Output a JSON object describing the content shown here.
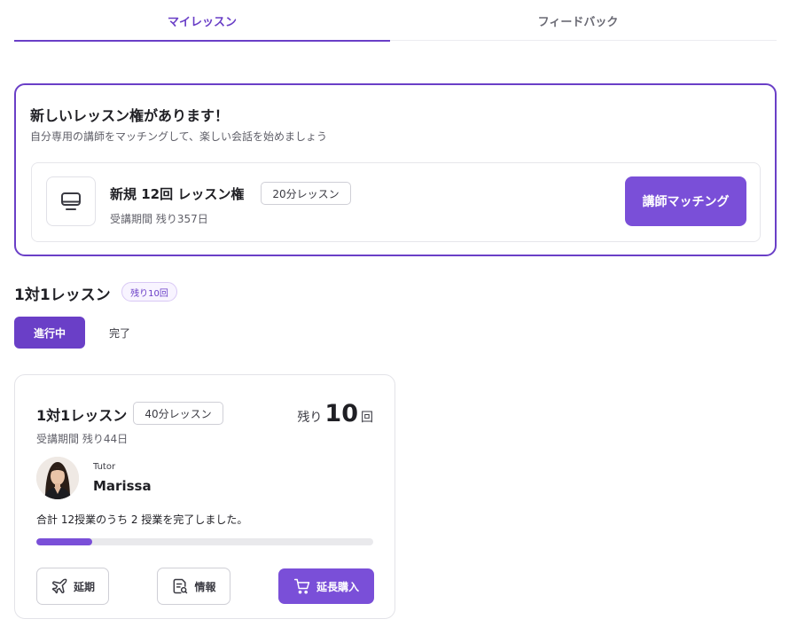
{
  "tabs": [
    {
      "label": "マイレッスン",
      "active": true
    },
    {
      "label": "フィードバック",
      "active": false
    }
  ],
  "new_ticket": {
    "title": "新しいレッスン権があります！",
    "subtitle": "自分専用の講師をマッチングして、楽しい会話を始めましょう",
    "icon": "monitor-icon",
    "plan_name": "新規 12回 レッスン権",
    "plan_badge": "20分レッスン",
    "period": "受講期間 残り357日",
    "match_button": "講師マッチング"
  },
  "section": {
    "title": "1対1レッスン",
    "remaining_pill": "残り10回",
    "filters": {
      "active": "進行中",
      "other": "完了"
    }
  },
  "lesson": {
    "name": "1対1レッスン",
    "badge": "40分レッスン",
    "remain_label": "残り",
    "remain_count": "10",
    "remain_unit": "回",
    "period": "受講期間 残り44日",
    "tutor_label": "Tutor",
    "tutor_name": "Marissa",
    "progress_text": "合計 12授業のうち 2 授業を完了しました。",
    "progress_completed": 2,
    "progress_total": 12,
    "buttons": {
      "postpone": "延期",
      "info": "情報",
      "buy": "延長購入"
    }
  },
  "colors": {
    "accent": "#6a3fc7",
    "accent_button": "#7a4fd8",
    "progress_track": "#e9e9ec"
  }
}
